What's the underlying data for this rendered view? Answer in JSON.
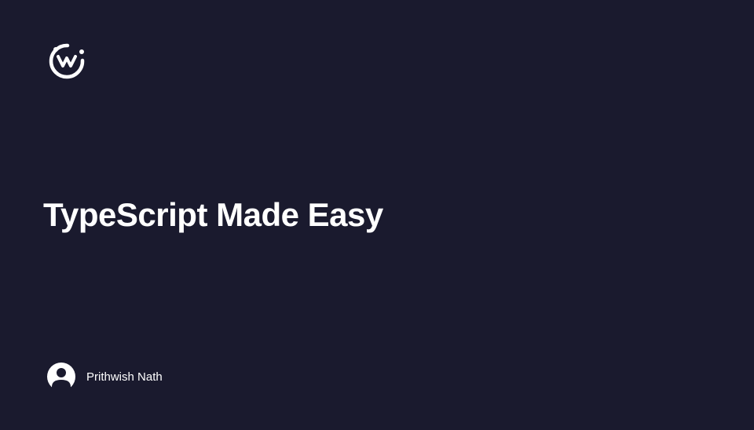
{
  "title": "TypeScript Made Easy",
  "author": {
    "name": "Prithwish Nath"
  }
}
